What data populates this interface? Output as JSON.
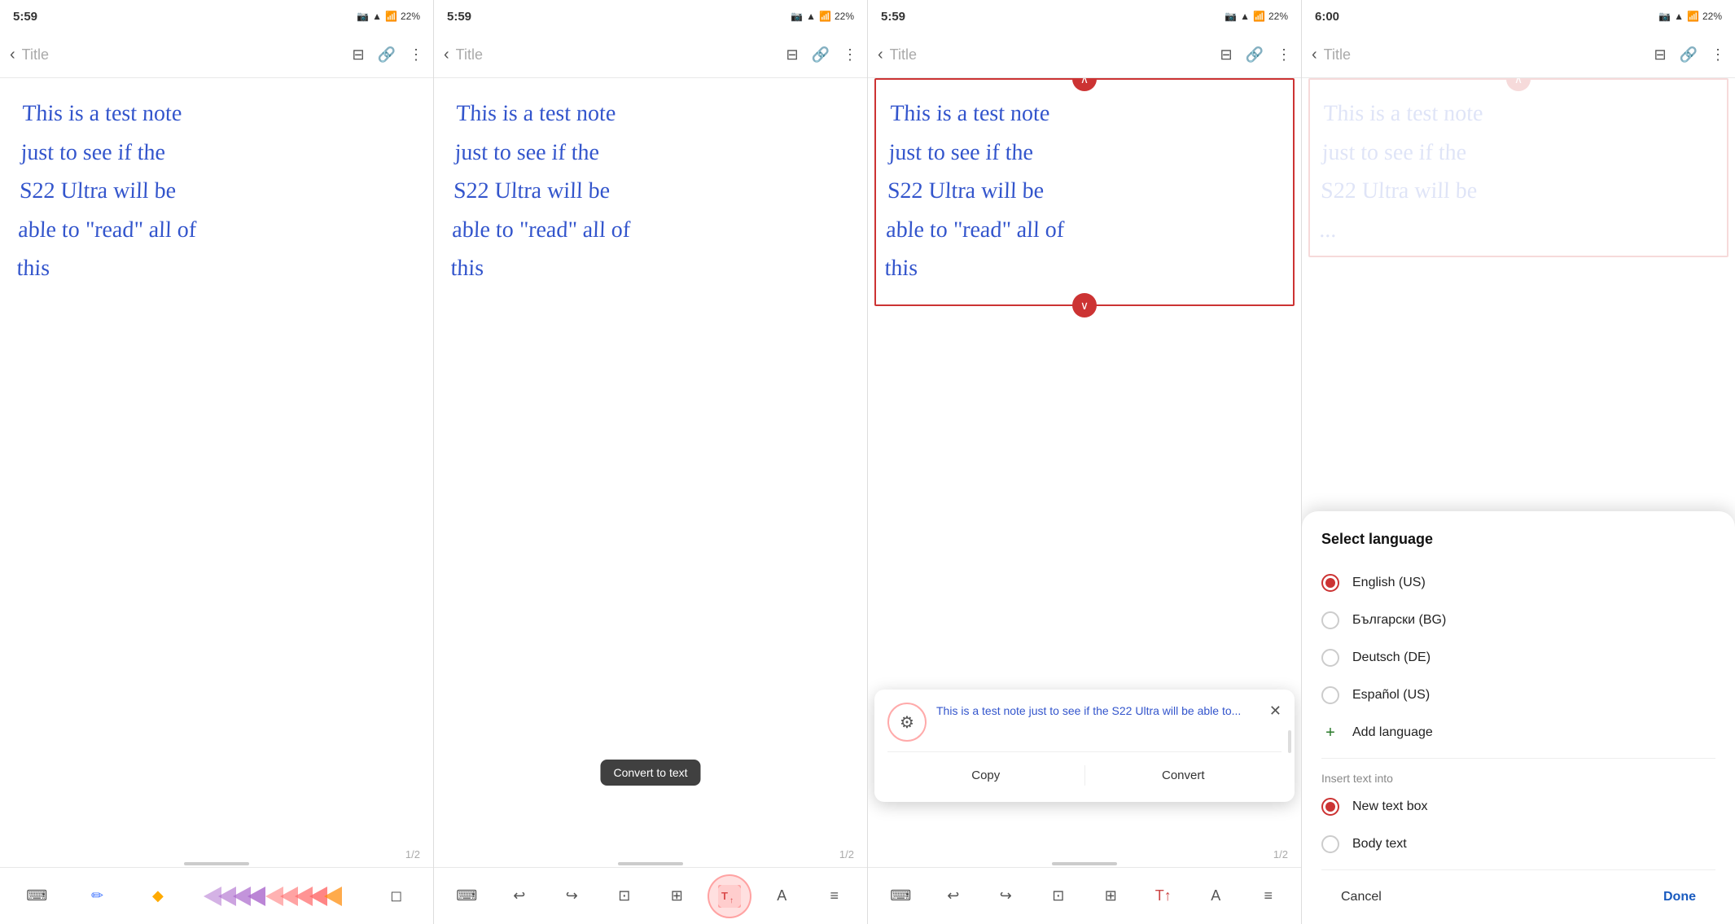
{
  "panels": [
    {
      "id": "panel1",
      "statusBar": {
        "time": "5:59",
        "cameraIcon": "📷",
        "wifiIcon": "📶",
        "batteryIcon": "🔋",
        "batteryLevel": "22%"
      },
      "topBar": {
        "backLabel": "‹",
        "title": "Title",
        "bookIcon": "⊟",
        "attachIcon": "🔗",
        "moreIcon": "⋮"
      },
      "handwritingText": "This is a test note just to see if the S22 Ultra will be able to \"read\" all of this",
      "pageIndicator": "1/2",
      "toolbar": {
        "keyboardIcon": "⌨",
        "penIcon": "✏",
        "highlighterIcon": "🖍",
        "arrowIcons": [
          "›",
          "›",
          "›",
          "›",
          "›",
          "›",
          "›",
          "›"
        ],
        "eraserIcon": "◻"
      }
    },
    {
      "id": "panel2",
      "statusBar": {
        "time": "5:59",
        "cameraIcon": "📷",
        "wifiIcon": "📶",
        "batteryIcon": "🔋",
        "batteryLevel": "22%"
      },
      "topBar": {
        "backLabel": "‹",
        "title": "Title",
        "bookIcon": "⊟",
        "attachIcon": "🔗",
        "moreIcon": "⋮"
      },
      "handwritingText": "This is a test note just to see if the S22 Ultra will be able to \"read\" all of this",
      "pageIndicator": "1/2",
      "tooltip": "Convert to text",
      "toolbar": {
        "keyboardIcon": "⌨",
        "undoIcon": "↩",
        "redoIcon": "↪",
        "selectIcon": "⊡",
        "formatIcon": "⊞",
        "convertToTextIcon": "T↑",
        "textIcon": "A",
        "moreIcon": "≡"
      }
    },
    {
      "id": "panel3",
      "statusBar": {
        "time": "5:59",
        "cameraIcon": "📷",
        "wifiIcon": "📶",
        "batteryIcon": "🔋",
        "batteryLevel": "22%"
      },
      "topBar": {
        "backLabel": "‹",
        "title": "Title",
        "bookIcon": "⊟",
        "attachIcon": "🔗",
        "moreIcon": "⋮"
      },
      "handwritingText": "This is a test note just to see if the S22 Ultra will be able to \"read\" all of this",
      "pageIndicator": "1/2",
      "convertPopup": {
        "convertedText": "This is a test note just to see if the S22 Ultra will be able to...",
        "copyLabel": "Copy",
        "convertLabel": "Convert"
      },
      "toolbar": {
        "keyboardIcon": "⌨",
        "undoIcon": "↩",
        "redoIcon": "↪",
        "selectIcon": "⊡",
        "formatIcon": "⊞",
        "convertToTextIcon": "T↑",
        "textIcon": "A",
        "moreIcon": "≡"
      }
    },
    {
      "id": "panel4",
      "statusBar": {
        "time": "6:00",
        "cameraIcon": "📷",
        "wifiIcon": "📶",
        "batteryIcon": "🔋",
        "batteryLevel": "22%"
      },
      "topBar": {
        "backLabel": "‹",
        "title": "Title",
        "bookIcon": "⊟",
        "attachIcon": "🔗",
        "moreIcon": "⋮"
      },
      "handwritingText": "This is a test note just to see if the S22 Ultra will be",
      "langDialog": {
        "title": "Select language",
        "languages": [
          {
            "name": "English (US)",
            "selected": true
          },
          {
            "name": "Български (BG)",
            "selected": false
          },
          {
            "name": "Deutsch (DE)",
            "selected": false
          },
          {
            "name": "Español (US)",
            "selected": false
          }
        ],
        "addLanguageLabel": "Add language",
        "insertTextIntoLabel": "Insert text into",
        "insertOptions": [
          {
            "name": "New text box",
            "selected": true
          },
          {
            "name": "Body text",
            "selected": false
          }
        ],
        "cancelLabel": "Cancel",
        "doneLabel": "Done"
      }
    }
  ]
}
